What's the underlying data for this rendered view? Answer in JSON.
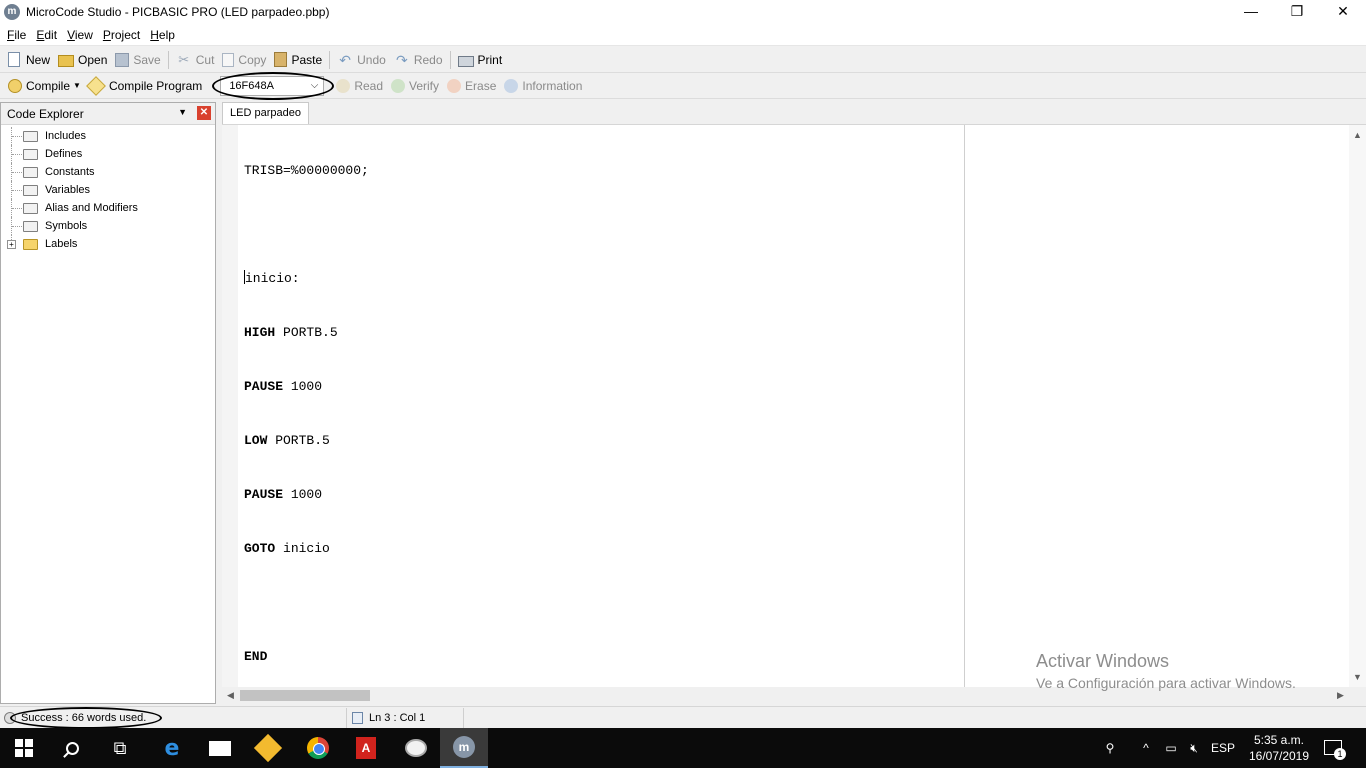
{
  "window": {
    "title": "MicroCode Studio - PICBASIC PRO (LED parpadeo.pbp)",
    "app_icon": "m",
    "controls": {
      "minimize": "—",
      "restore": "❐",
      "close": "✕"
    }
  },
  "menu": [
    {
      "underline": "F",
      "rest": "ile"
    },
    {
      "underline": "E",
      "rest": "dit"
    },
    {
      "underline": "V",
      "rest": "iew"
    },
    {
      "underline": "P",
      "rest": "roject"
    },
    {
      "underline": "H",
      "rest": "elp"
    }
  ],
  "toolbar1": {
    "new": "New",
    "open": "Open",
    "save": "Save",
    "cut": "Cut",
    "copy": "Copy",
    "paste": "Paste",
    "undo": "Undo",
    "redo": "Redo",
    "print": "Print"
  },
  "toolbar2": {
    "compile": "Compile",
    "compile_program": "Compile Program",
    "device": "16F648A",
    "read": "Read",
    "verify": "Verify",
    "erase": "Erase",
    "information": "Information"
  },
  "explorer": {
    "title": "Code Explorer",
    "items": [
      "Includes",
      "Defines",
      "Constants",
      "Variables",
      "Alias and Modifiers",
      "Symbols",
      "Labels"
    ],
    "expander": "+",
    "close": "✕",
    "pin": "▼"
  },
  "editor": {
    "tab": "LED parpadeo",
    "lines": [
      {
        "kw": "",
        "text": "TRISB=%00000000;"
      },
      {
        "kw": "",
        "text": ""
      },
      {
        "kw": "",
        "text": "inicio:"
      },
      {
        "kw": "HIGH",
        "text": " PORTB.5"
      },
      {
        "kw": "PAUSE",
        "text": " 1000"
      },
      {
        "kw": "LOW",
        "text": " PORTB.5"
      },
      {
        "kw": "PAUSE",
        "text": " 1000"
      },
      {
        "kw": "GOTO",
        "text": " inicio"
      },
      {
        "kw": "",
        "text": ""
      },
      {
        "kw": "END",
        "text": ""
      }
    ]
  },
  "watermark": {
    "line1": "Activar Windows",
    "line2": "Ve a Configuración para activar Windows."
  },
  "status": {
    "message": "Success : 66 words used.",
    "position": "Ln 3 : Col 1"
  },
  "taskbar": {
    "language": "ESP",
    "time": "5:35 a.m.",
    "date": "16/07/2019",
    "notifications": "1"
  }
}
